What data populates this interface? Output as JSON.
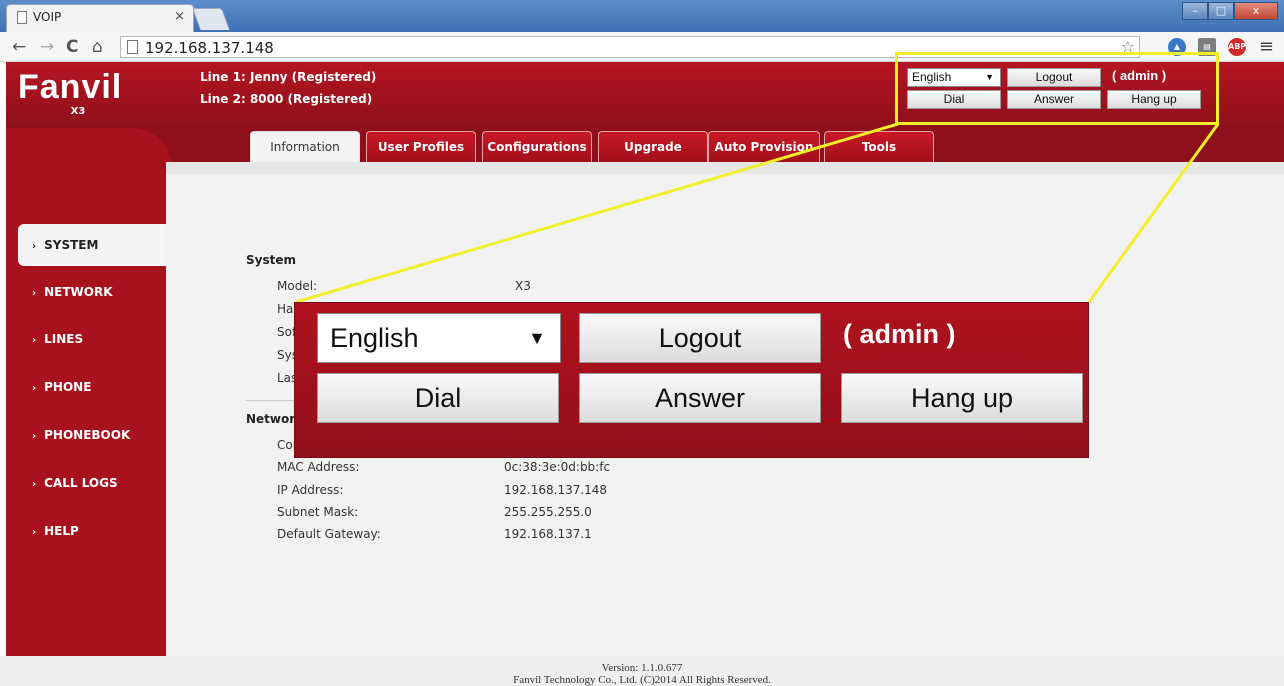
{
  "browser": {
    "tab_title": "VOIP",
    "tab_close": "×",
    "url": "192.168.137.148",
    "win_minimize": "–",
    "win_maximize": "□",
    "win_close": "x"
  },
  "header": {
    "logo": "Fanvil",
    "model_badge": "X3",
    "line1": "Line 1: Jenny (Registered)",
    "line2": "Line 2: 8000  (Registered)",
    "language": "English",
    "language_arrow": "▼",
    "logout_label": "Logout",
    "admin_label": "( admin )",
    "dial_label": "Dial",
    "answer_label": "Answer",
    "hangup_label": "Hang up"
  },
  "tabs": [
    {
      "label": "Information",
      "active": true
    },
    {
      "label": "User Profiles"
    },
    {
      "label": "Configurations"
    },
    {
      "label": "Upgrade"
    },
    {
      "label": "Auto Provision"
    },
    {
      "label": "Tools"
    }
  ],
  "sidebar": {
    "chevron": "›",
    "items": [
      {
        "label": "SYSTEM",
        "active": true
      },
      {
        "label": "NETWORK"
      },
      {
        "label": "LINES"
      },
      {
        "label": "PHONE"
      },
      {
        "label": "PHONEBOOK"
      },
      {
        "label": "CALL LOGS"
      },
      {
        "label": "HELP"
      }
    ]
  },
  "system_section": {
    "title": "System",
    "rows": [
      {
        "label": "Model:",
        "value": "X3"
      },
      {
        "label": "Har"
      },
      {
        "label": "Sof"
      },
      {
        "label": "Sys"
      },
      {
        "label": "Las"
      }
    ]
  },
  "network_section": {
    "title": "Networ",
    "rows": [
      {
        "label": "Cor"
      },
      {
        "label": "MAC Address:",
        "value": "0c:38:3e:0d:bb:fc"
      },
      {
        "label": "IP Address:",
        "value": "192.168.137.148"
      },
      {
        "label": "Subnet Mask:",
        "value": "255.255.255.0"
      },
      {
        "label": "Default Gateway:",
        "value": "192.168.137.1"
      }
    ]
  },
  "footer": {
    "version": "Version: 1.1.0.677",
    "copyright": "Fanvil Technology Co., Ltd. (C)2014 All Rights Reserved."
  },
  "colors": {
    "brand_red": "#a8121e",
    "highlight_yellow": "#f2ee2b"
  }
}
